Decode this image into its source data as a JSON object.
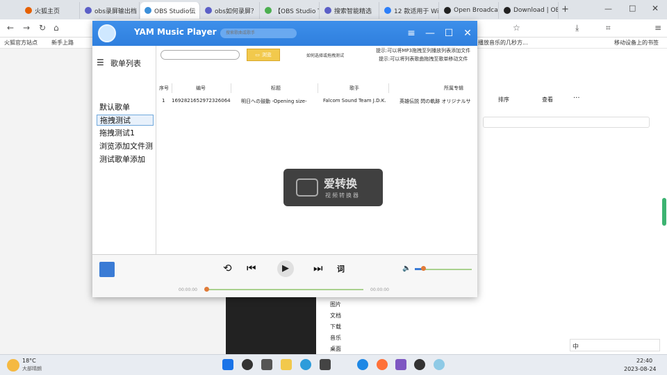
{
  "browser": {
    "tabs": [
      {
        "label": "火狐主页",
        "color": "#e66000"
      },
      {
        "label": "obs录屏输出档",
        "color": "#5b5fc7"
      },
      {
        "label": "OBS Studio伝",
        "color": "#3b8fd9"
      },
      {
        "label": "obs如何录屏？",
        "color": "#5b5fc7"
      },
      {
        "label": "【OBS Studio T",
        "color": "#4caf50"
      },
      {
        "label": "搜索智能精选",
        "color": "#5b5fc7"
      },
      {
        "label": "12 款适用于 Wi",
        "color": "#2d7ff9"
      },
      {
        "label": "Open Broadcas",
        "color": "#222222"
      },
      {
        "label": "Download | OBS",
        "color": "#222222"
      }
    ],
    "bookmarks": [
      "火狐官方站点",
      "新手上路",
      "播放音乐的几秒方...",
      "移动设备上的书签"
    ]
  },
  "explorer": {
    "toolbar": [
      "排序",
      "查看"
    ],
    "folders": [
      "图片",
      "文档",
      "下载",
      "音乐",
      "桌面"
    ]
  },
  "app": {
    "title": "YAM Music Player",
    "search_placeholder": "搜索歌曲或歌手",
    "sidebar": {
      "header": "歌单列表",
      "items": [
        "默认歌单",
        "拖拽测试",
        "拖拽测试1",
        "浏览添加文件测",
        "测试歌单添加"
      ]
    },
    "toolbar": {
      "browse_label": "浏览",
      "hint_mid": "如何选择或拖拽测试",
      "hint_right_1": "提示:可以将MP3拖拽至列播放列表添加文件",
      "hint_right_2": "提示:可以将列表歌曲拖拽至歌单移动文件"
    },
    "table": {
      "headers": [
        "序号",
        "编号",
        "标题",
        "歌手",
        "所属专辑"
      ],
      "rows": [
        [
          "1",
          "1692821652972326064",
          "明日への鼓動 -Opening size-",
          "Falcom Sound Team J.D.K.",
          "英雄伝説 閃の軌跡 オリジナルサ"
        ]
      ]
    },
    "player": {
      "lyrics_label": "词",
      "time_current": "00:00:00",
      "time_total": "00:00:00",
      "volume": 0.15,
      "progress": 0.0
    }
  },
  "watermark": {
    "title": "爱转换",
    "subtitle": "视频转换器"
  },
  "taskbar": {
    "weather_temp": "18°C",
    "weather_desc": "大部晴朗",
    "ime_label": "中",
    "time": "22:40",
    "date": "2023-08-24"
  }
}
